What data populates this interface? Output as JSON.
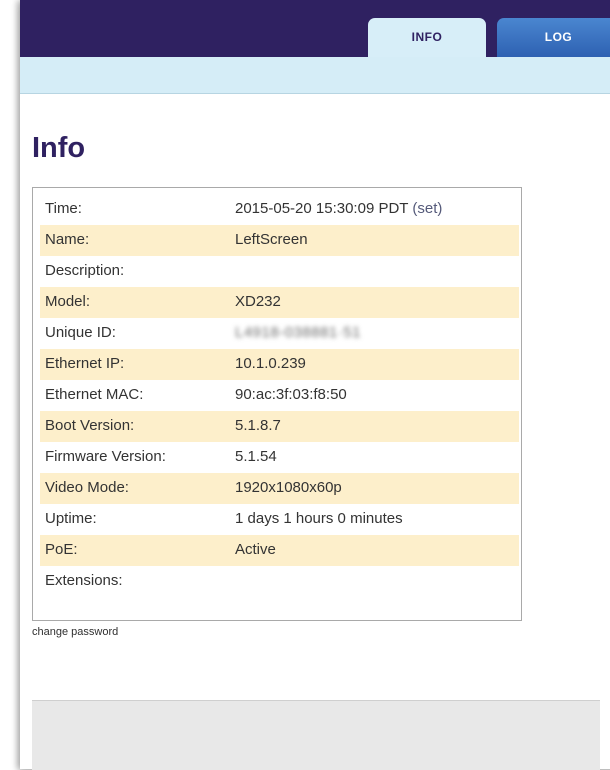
{
  "tabs": {
    "info": "INFO",
    "log": "LOG"
  },
  "page": {
    "title": "Info"
  },
  "info_rows": [
    {
      "label": "Time:",
      "value": "2015-05-20 15:30:09 PDT",
      "extra": "(set)"
    },
    {
      "label": "Name:",
      "value": "LeftScreen"
    },
    {
      "label": "Description:",
      "value": ""
    },
    {
      "label": "Model:",
      "value": "XD232"
    },
    {
      "label": "Unique ID:",
      "value": "L4918-038881·51"
    },
    {
      "label": "Ethernet IP:",
      "value": "10.1.0.239"
    },
    {
      "label": "Ethernet MAC:",
      "value": "90:ac:3f:03:f8:50"
    },
    {
      "label": "Boot Version:",
      "value": "5.1.8.7"
    },
    {
      "label": "Firmware Version:",
      "value": "5.1.54"
    },
    {
      "label": "Video Mode:",
      "value": "1920x1080x60p"
    },
    {
      "label": "Uptime:",
      "value": "1 days 1 hours 0 minutes"
    },
    {
      "label": "PoE:",
      "value": "Active"
    },
    {
      "label": "Extensions:",
      "value": ""
    }
  ],
  "links": {
    "change_password": "change password"
  },
  "colors": {
    "header": "#2f2161",
    "subbar": "#d5edf7",
    "row_alt": "#fdefcb",
    "tab_log": "#3a70c0",
    "title": "#2f2161"
  }
}
